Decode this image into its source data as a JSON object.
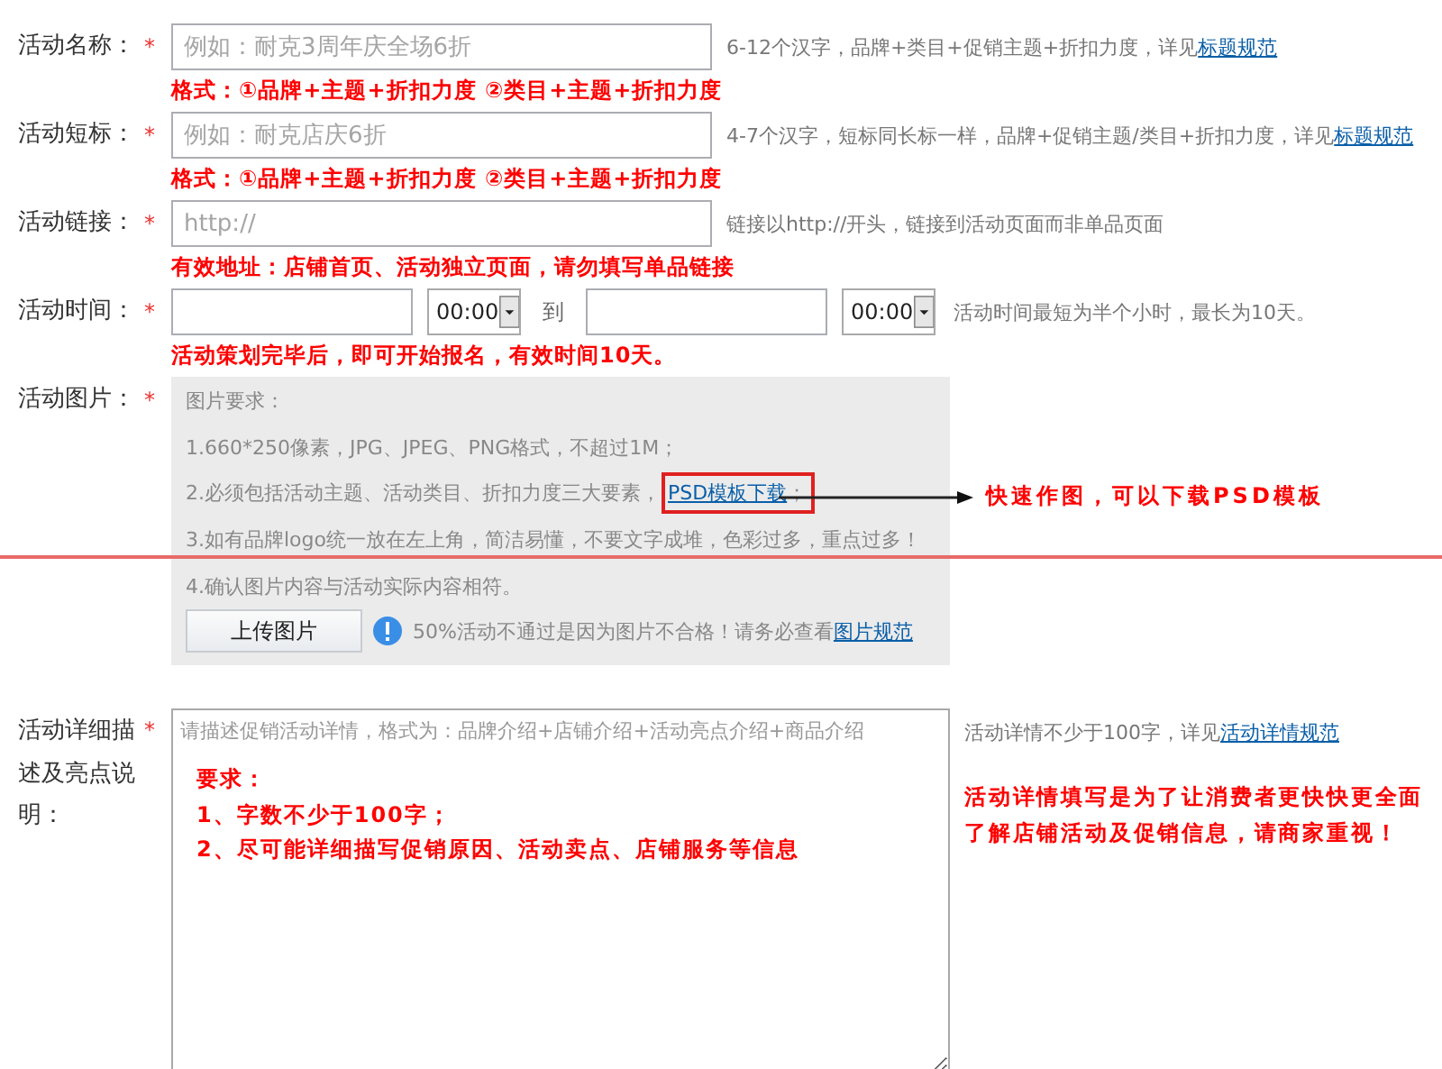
{
  "form": {
    "rows": [
      {
        "kind": "text",
        "label": "活动名称：",
        "mark": "*",
        "placeholder": "例如：耐克3周年庆全场6折",
        "hint": "6-12个汉字，品牌+类目+促销主题+折扣力度，详见",
        "hint_link": "标题规范",
        "note": "格式：①品牌+主题+折扣力度  ②类目+主题+折扣力度"
      },
      {
        "kind": "text",
        "label": "活动短标：",
        "mark": "*",
        "placeholder": "例如：耐克店庆6折",
        "hint": "4-7个汉字，短标同长标一样，品牌+促销主题/类目+折扣力度，详见",
        "hint_link": "标题规范",
        "note": "格式：①品牌+主题+折扣力度  ②类目+主题+折扣力度"
      },
      {
        "kind": "text",
        "label": "活动链接：",
        "mark": "*",
        "placeholder": "http://",
        "hint": "链接以http://开头，链接到活动页面而非单品页面",
        "note": "有效地址：店铺首页、活动独立页面，请勿填写单品链接"
      },
      {
        "kind": "datetime",
        "label": "活动时间：",
        "mark": "*",
        "start_time": "00:00",
        "separator": "到",
        "end_time": "00:00",
        "hint": "活动时间最短为半个小时，最长为10天。",
        "note": "活动策划完毕后，即可开始报名，有效时间10天。"
      },
      {
        "kind": "image",
        "label": "活动图片：",
        "mark": "*",
        "title": "图片要求：",
        "lines": [
          {
            "text": "1.660*250像素，JPG、JPEG、PNG格式，不超过1M；"
          },
          {
            "text": "2.必须包括活动主题、活动类目、折扣力度三大要素，",
            "link": "PSD模板下载",
            "link_suffix": "；"
          },
          {
            "text": "3.如有品牌logo统一放在左上角，简洁易懂，不要文字成堆，色彩过多，重点过多！"
          },
          {
            "text": "4.确认图片内容与活动实际内容相符。"
          }
        ],
        "upload_button": "上传图片",
        "warning": "50%活动不通过是因为图片不合格！请务必查看",
        "warning_link": "图片规范",
        "callout": "快速作图，可以下载PSD模板"
      },
      {
        "kind": "textarea",
        "label": "活动详细描述及亮点说明：",
        "mark": "*",
        "placeholder": "请描述促销活动详情，格式为：品牌介绍+店铺介绍+活动亮点介绍+商品介绍",
        "requirements": [
          "要求：",
          "1、字数不少于100字；",
          "2、尽可能详细描写促销原因、活动卖点、店铺服务等信息"
        ],
        "hint": "活动详情不少于100字，详见",
        "hint_link": "活动详情规范",
        "note": "活动详情填写是为了让消费者更快快更全面了解店铺活动及促销信息，请商家重视！"
      }
    ]
  }
}
